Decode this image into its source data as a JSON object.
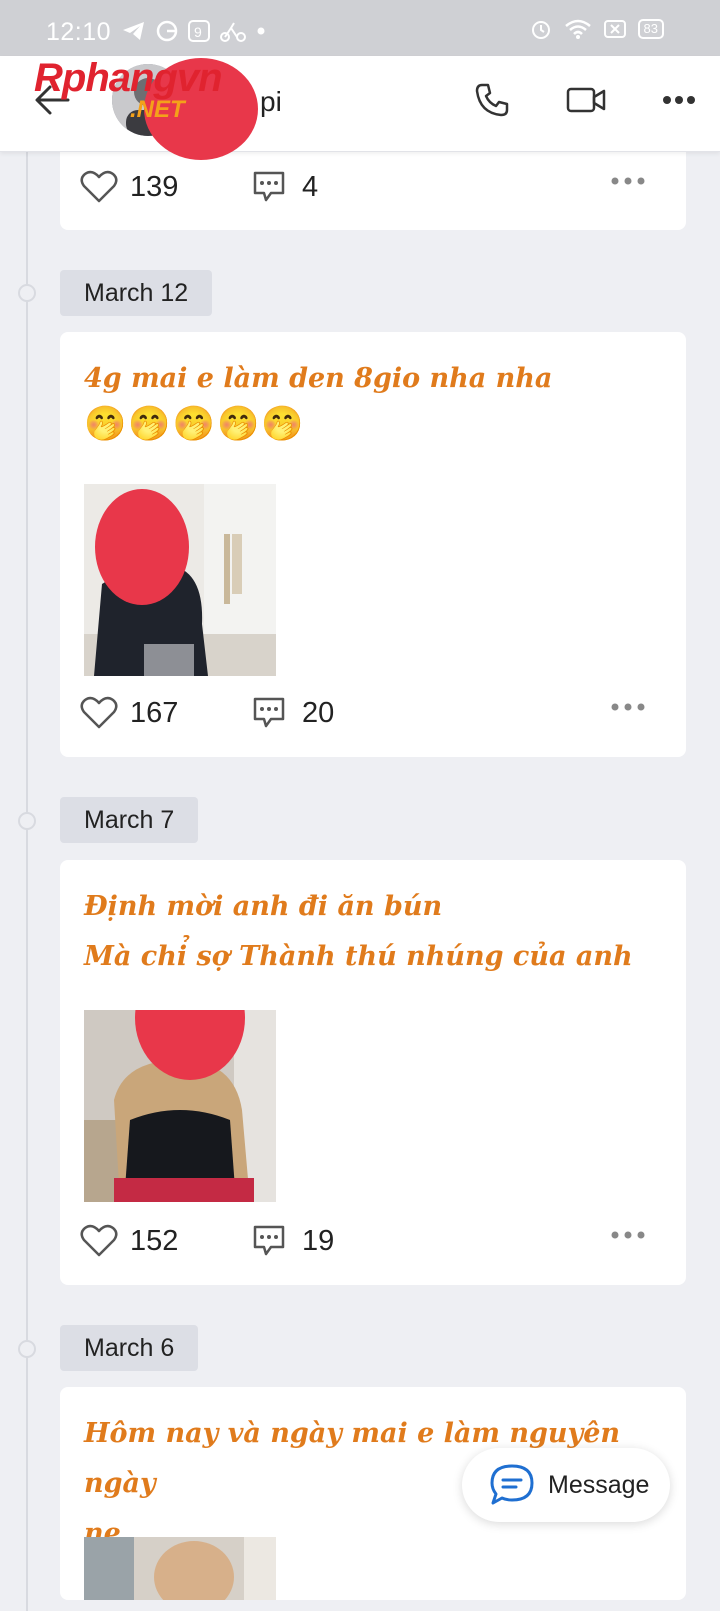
{
  "status_bar": {
    "time": "12:10",
    "battery": "83",
    "icons": [
      "telegram-icon",
      "g-icon",
      "9-icon",
      "delivery-icon",
      "dot-icon",
      "alarm-icon",
      "wifi-icon",
      "no-sim-icon",
      "battery-icon"
    ]
  },
  "header": {
    "contact_name_partial": "pi",
    "watermark_line1": "Rphangvn",
    "watermark_line2": ".NET",
    "icons": [
      "back-arrow-icon",
      "phone-icon",
      "video-camera-icon",
      "more-icon"
    ]
  },
  "posts": [
    {
      "likes": "139",
      "comments": "4"
    },
    {
      "date": "March 12",
      "text": "4g mai e làm den 8gio nha nha",
      "emoji": "🤭🤭🤭🤭🤭",
      "likes": "167",
      "comments": "20"
    },
    {
      "date": "March 7",
      "text": "Định mời anh đi ăn bún\nMà chỉ sợ Thành thú nhúng của anh",
      "likes": "152",
      "comments": "19"
    },
    {
      "date": "March 6",
      "text": "Hôm nay và ngày mai e làm nguyên ngày\nne"
    }
  ],
  "message_button": {
    "label": "Message"
  },
  "colors": {
    "post_text": "#e07b1c",
    "redaction": "#e8374a",
    "background": "#eeeff3",
    "accent_blue": "#1f6fd1"
  }
}
